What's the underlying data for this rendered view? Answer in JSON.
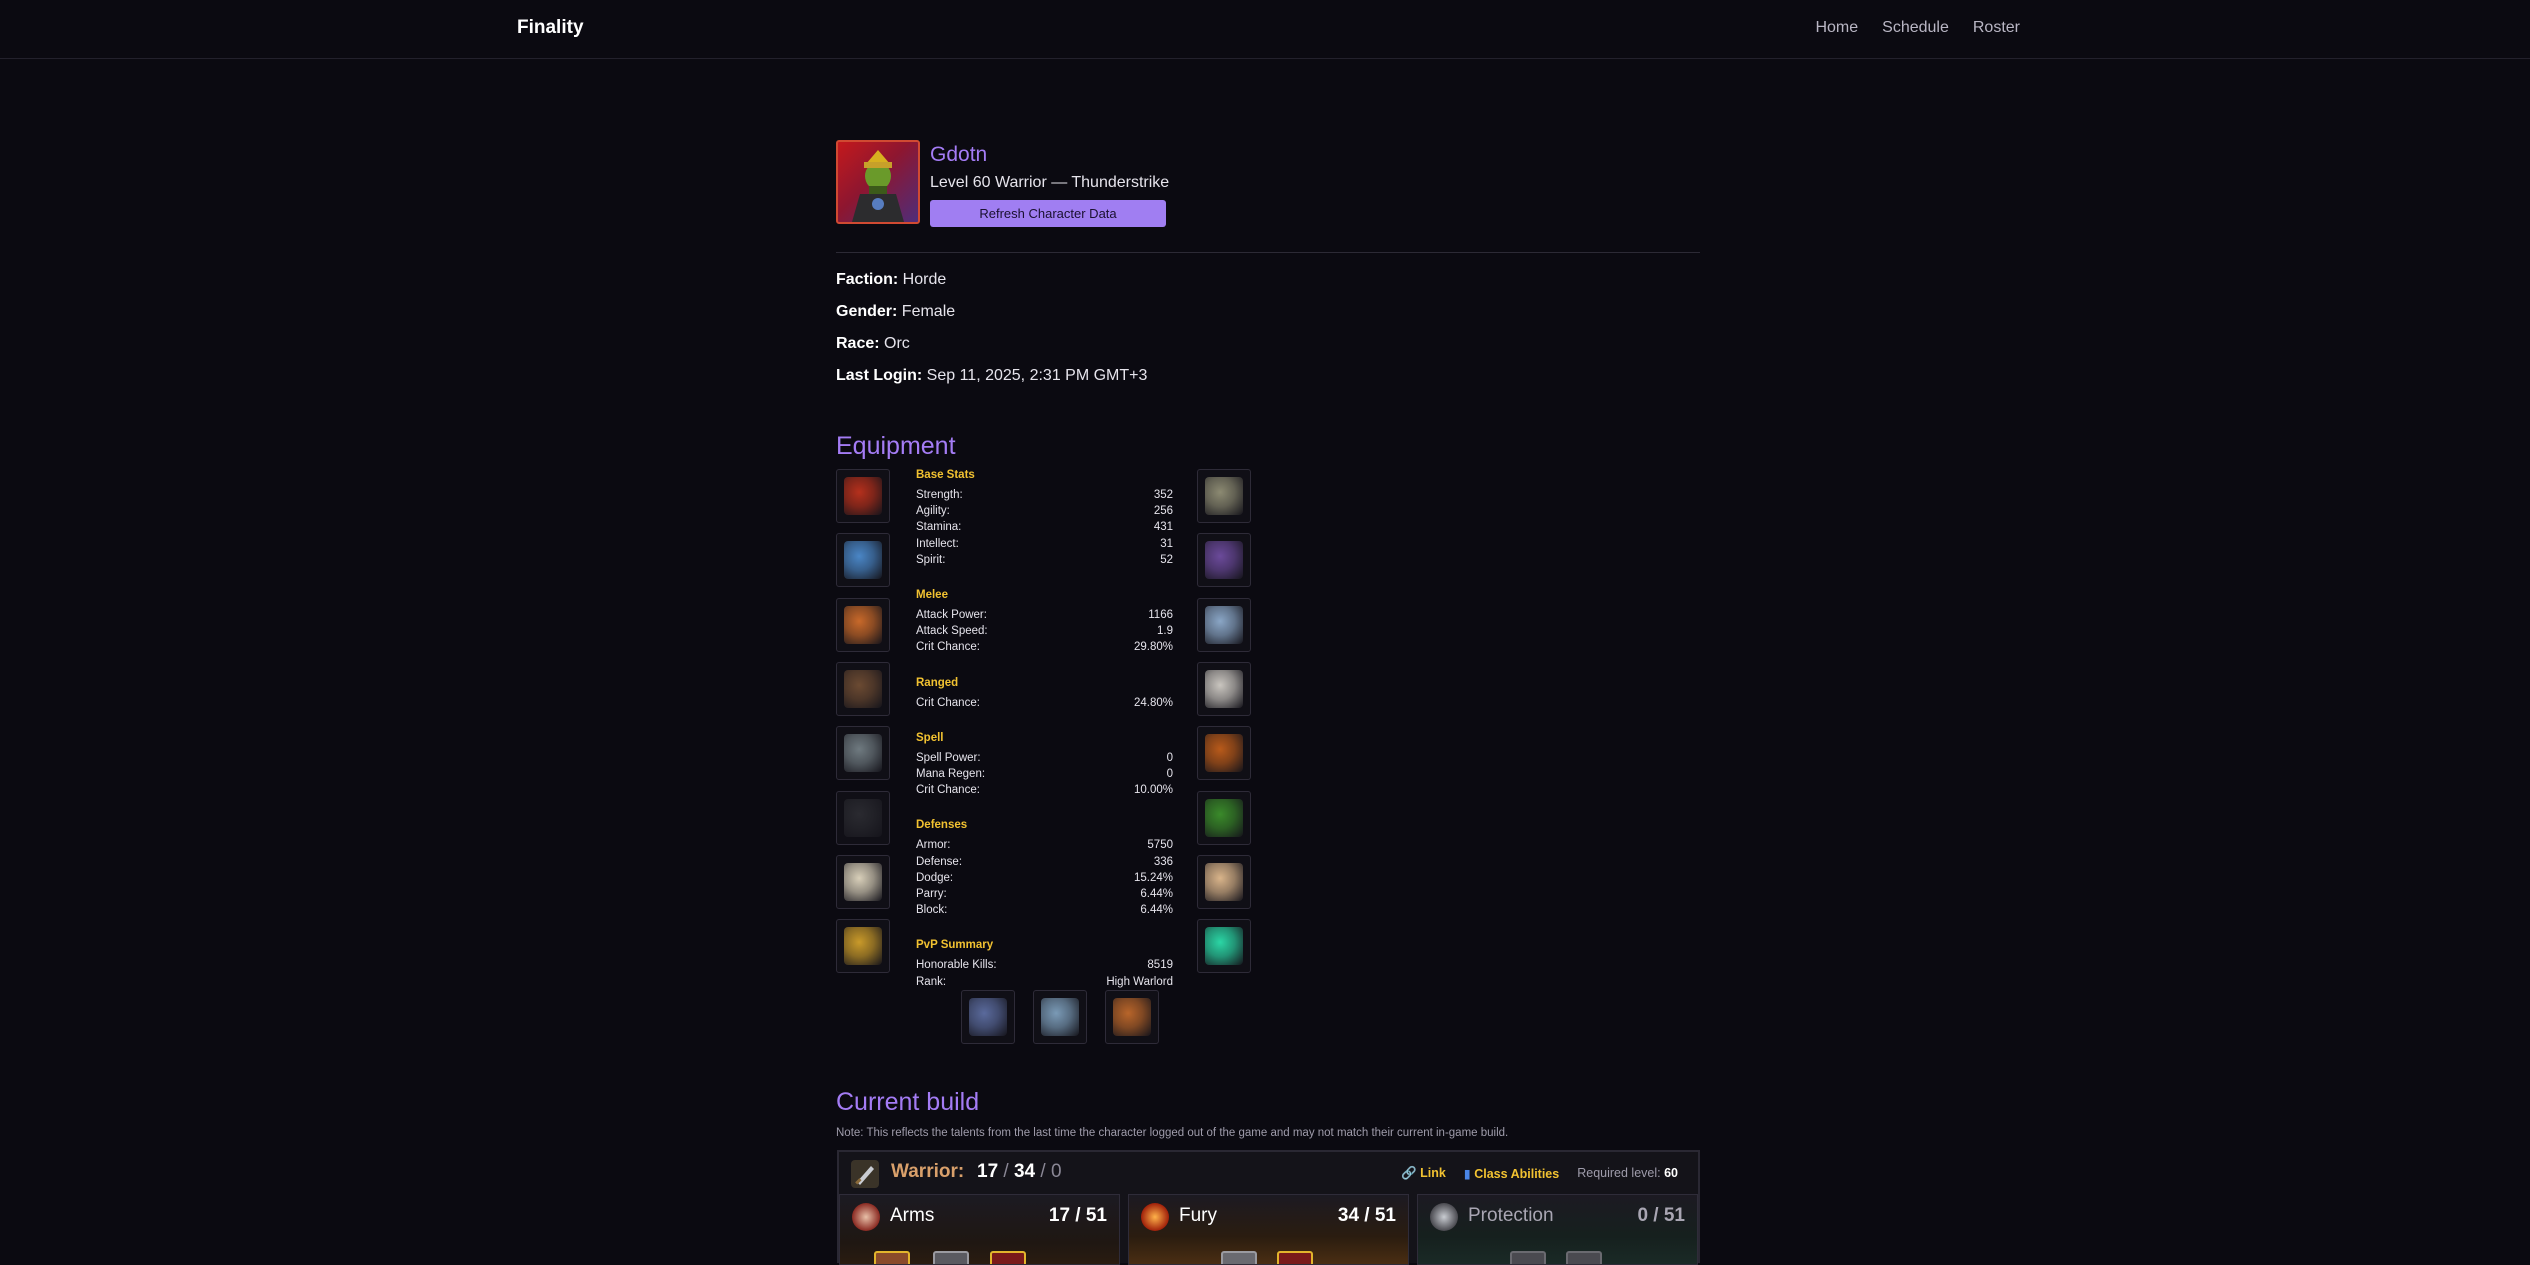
{
  "nav": {
    "brand": "Finality",
    "links": [
      "Home",
      "Schedule",
      "Roster"
    ]
  },
  "character": {
    "name": "Gdotn",
    "subtitle": "Level 60 Warrior — Thunderstrike",
    "refresh_label": "Refresh Character Data",
    "info": [
      {
        "label": "Faction:",
        "value": "Horde"
      },
      {
        "label": "Gender:",
        "value": "Female"
      },
      {
        "label": "Race:",
        "value": "Orc"
      },
      {
        "label": "Last Login:",
        "value": "Sep 11, 2025, 2:31 PM GMT+3"
      }
    ]
  },
  "equipment": {
    "title": "Equipment",
    "left_slots": [
      "head-item-icon",
      "neck-item-icon",
      "shoulder-item-icon",
      "back-item-icon",
      "chest-item-icon",
      "shirt-item-icon",
      "tabard-item-icon",
      "wrist-item-icon"
    ],
    "right_slots": [
      "hands-item-icon",
      "waist-item-icon",
      "legs-item-icon",
      "feet-item-icon",
      "ring-1-item-icon",
      "ring-2-item-icon",
      "trinket-1-item-icon",
      "trinket-2-item-icon"
    ],
    "weapon_slots": [
      "main-hand-item-icon",
      "off-hand-item-icon",
      "ranged-item-icon"
    ],
    "colors": {
      "left": [
        "#b5301c",
        "#4a86c6",
        "#c8692a",
        "#6b4a32",
        "#6f7a80",
        "#2a2a30",
        "#d8cfb9",
        "#c99a2a"
      ],
      "right": [
        "#8c8a72",
        "#6b4a9a",
        "#8aa6c6",
        "#c9c5bf",
        "#b85a1a",
        "#3a8a2a",
        "#d9b48a",
        "#2bd6a5"
      ],
      "weapons": [
        "#5a6a9c",
        "#7a9ab6",
        "#b8652a"
      ]
    },
    "stat_groups": [
      {
        "title": "Base Stats",
        "rows": [
          {
            "label": "Strength:",
            "value": "352"
          },
          {
            "label": "Agility:",
            "value": "256"
          },
          {
            "label": "Stamina:",
            "value": "431"
          },
          {
            "label": "Intellect:",
            "value": "31"
          },
          {
            "label": "Spirit:",
            "value": "52"
          }
        ]
      },
      {
        "title": "Melee",
        "rows": [
          {
            "label": "Attack Power:",
            "value": "1166"
          },
          {
            "label": "Attack Speed:",
            "value": "1.9"
          },
          {
            "label": "Crit Chance:",
            "value": "29.80%"
          }
        ]
      },
      {
        "title": "Ranged",
        "rows": [
          {
            "label": "Crit Chance:",
            "value": "24.80%"
          }
        ]
      },
      {
        "title": "Spell",
        "rows": [
          {
            "label": "Spell Power:",
            "value": "0"
          },
          {
            "label": "Mana Regen:",
            "value": "0"
          },
          {
            "label": "Crit Chance:",
            "value": "10.00%"
          }
        ]
      },
      {
        "title": "Defenses",
        "rows": [
          {
            "label": "Armor:",
            "value": "5750"
          },
          {
            "label": "Defense:",
            "value": "336"
          },
          {
            "label": "Dodge:",
            "value": "15.24%"
          },
          {
            "label": "Parry:",
            "value": "6.44%"
          },
          {
            "label": "Block:",
            "value": "6.44%"
          }
        ]
      },
      {
        "title": "PvP Summary",
        "rows": [
          {
            "label": "Honorable Kills:",
            "value": "8519"
          },
          {
            "label": "Rank:",
            "value": "High Warlord"
          }
        ]
      }
    ]
  },
  "build": {
    "title": "Current build",
    "note": "Note: This reflects the talents from the last time the character logged out of the game and may not match their current in-game build.",
    "class_label": "Warrior:",
    "points": {
      "a": "17",
      "b": "34",
      "c": "0",
      "sep": " / "
    },
    "link_label": "Link",
    "abilities_label": "Class Abilities",
    "required_label": "Required level:",
    "required_value": "60",
    "trees": [
      {
        "name": "Arms",
        "points": "17 / 51",
        "color": "#ffffff"
      },
      {
        "name": "Fury",
        "points": "34 / 51",
        "color": "#ffffff"
      },
      {
        "name": "Protection",
        "points": "0 / 51",
        "color": "#a9a6b3"
      }
    ]
  }
}
